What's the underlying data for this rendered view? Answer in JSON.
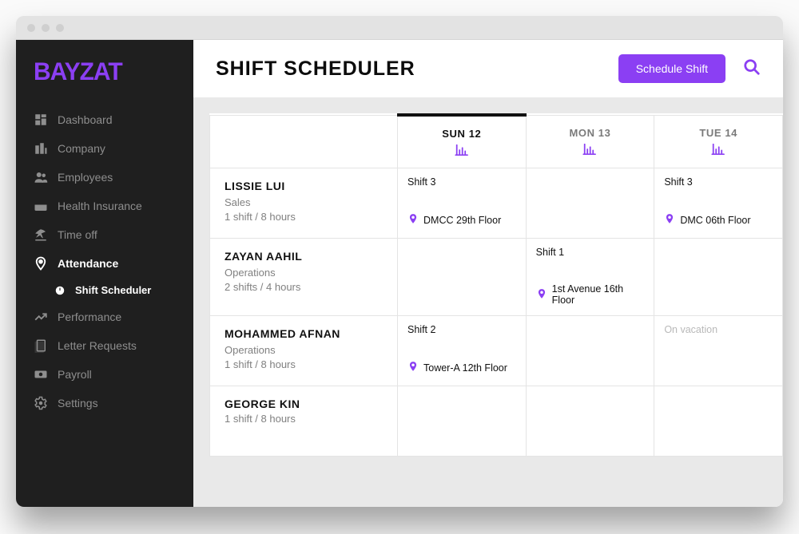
{
  "logo": "BAYZAT",
  "sidebar": [
    {
      "icon": "dashboard",
      "label": "Dashboard",
      "active": false
    },
    {
      "icon": "company",
      "label": "Company",
      "active": false
    },
    {
      "icon": "employees",
      "label": "Employees",
      "active": false
    },
    {
      "icon": "health",
      "label": "Health Insurance",
      "active": false
    },
    {
      "icon": "timeoff",
      "label": "Time off",
      "active": false
    },
    {
      "icon": "attendance",
      "label": "Attendance",
      "active": true
    },
    {
      "icon": "performance",
      "label": "Performance",
      "active": false
    },
    {
      "icon": "letter",
      "label": "Letter Requests",
      "active": false
    },
    {
      "icon": "payroll",
      "label": "Payroll",
      "active": false
    },
    {
      "icon": "settings",
      "label": "Settings",
      "active": false
    }
  ],
  "sidebar_sub": {
    "label": "Shift Scheduler"
  },
  "header": {
    "title": "SHIFT SCHEDULER",
    "button": "Schedule Shift"
  },
  "days": [
    {
      "label": "SUN 12",
      "active": true
    },
    {
      "label": "MON 13",
      "active": false
    },
    {
      "label": "TUE 14",
      "active": false
    }
  ],
  "employees": [
    {
      "name": "LISSIE LUI",
      "dept": "Sales",
      "stat": "1 shift / 8 hours",
      "cells": [
        {
          "shift": "Shift 3",
          "location": "DMCC 29th Floor"
        },
        null,
        {
          "shift": "Shift 3",
          "location": "DMC 06th Floor"
        }
      ]
    },
    {
      "name": "ZAYAN AAHIL",
      "dept": "Operations",
      "stat": "2 shifts / 4 hours",
      "cells": [
        null,
        {
          "shift": "Shift 1",
          "location": "1st Avenue 16th Floor"
        },
        null
      ]
    },
    {
      "name": "MOHAMMED AFNAN",
      "dept": "Operations",
      "stat": "1 shift / 8 hours",
      "cells": [
        {
          "shift": "Shift 2",
          "location": "Tower-A 12th Floor"
        },
        null,
        {
          "note": "On vacation"
        }
      ]
    },
    {
      "name": "GEORGE KIN",
      "dept": "",
      "stat": "1 shift / 8 hours",
      "cells": [
        null,
        null,
        null
      ]
    }
  ]
}
